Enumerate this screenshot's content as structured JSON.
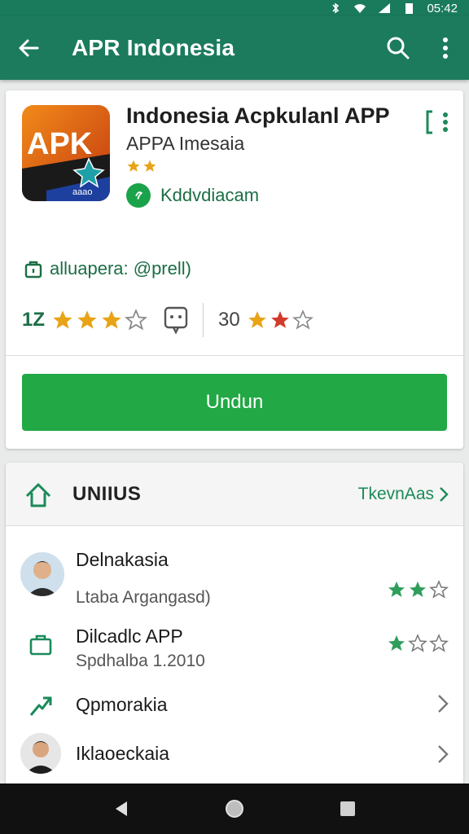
{
  "status_bar": {
    "time": "05:42"
  },
  "app_bar": {
    "title": "APR Indonesia"
  },
  "app": {
    "icon_text": "APK",
    "icon_subtext": "aaao",
    "title": "Indonesia Acpkulanl APP",
    "subtitle": "APPA Imesaia",
    "small_rating": 2,
    "developer": "Kddvdiacam",
    "meta": "alluapera: @prell)",
    "rating_count": "1Z",
    "rating_stars": 3,
    "second_count": "30",
    "second_stars": 2
  },
  "install_button": {
    "label": "Undun"
  },
  "section": {
    "title": "UNIIUS",
    "more_label": "TkevnAas",
    "items": [
      {
        "title": "Delnakasia",
        "subtitle": "Ltaba Argangasd)",
        "stars": 2.5,
        "lead": "avatar"
      },
      {
        "title": "Dilcadlc APP",
        "subtitle": "Spdhalba 1.2010",
        "stars": 1.5,
        "lead": "bag-icon"
      },
      {
        "title": "Qpmorakia",
        "subtitle": "",
        "lead": "trending-icon"
      },
      {
        "title": "Iklaoeckaia",
        "subtitle": "",
        "lead": "avatar"
      }
    ]
  },
  "colors": {
    "primary": "#1c7b5d",
    "accent": "#22a845",
    "star_gold": "#e8a317",
    "star_red": "#d23a2a",
    "star_green": "#2e9e5b"
  }
}
